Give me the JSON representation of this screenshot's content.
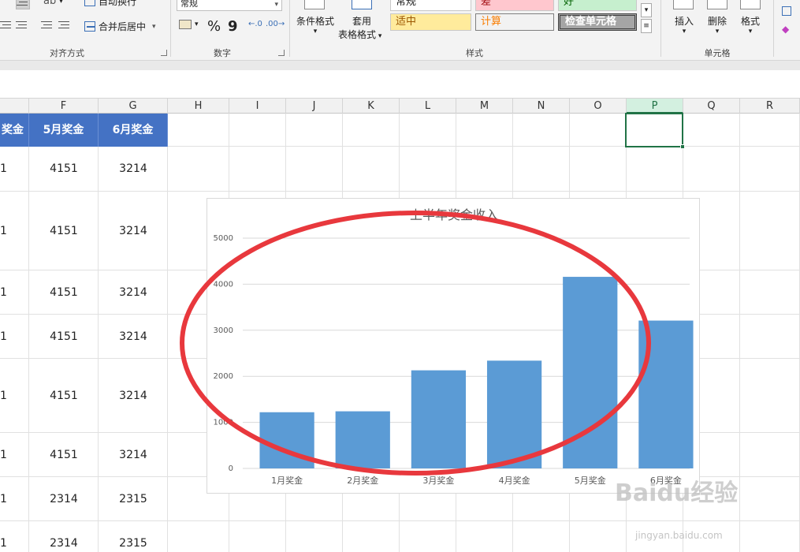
{
  "ribbon": {
    "alignment": {
      "wrap_text": "自动换行",
      "merge_center": "合并后居中",
      "group_label": "对齐方式"
    },
    "number": {
      "format_value": "常规",
      "percent": "%",
      "comma": "9",
      "group_label": "数字"
    },
    "styles": {
      "conditional_format": "条件格式",
      "table_format_line1": "套用",
      "table_format_line2": "表格格式",
      "cells": [
        {
          "label": "常规",
          "bg": "#ffffff",
          "color": "#222222"
        },
        {
          "label": "差",
          "bg": "#ffc7ce",
          "color": "#9c0006"
        },
        {
          "label": "好",
          "bg": "#c6efce",
          "color": "#006100"
        },
        {
          "label": "适中",
          "bg": "#ffeb9c",
          "color": "#9c5700"
        },
        {
          "label": "计算",
          "bg": "#f2f2f2",
          "color": "#fa7d00"
        },
        {
          "label": "检查单元格",
          "bg": "#a5a5a5",
          "color": "#ffffff"
        }
      ],
      "group_label": "样式"
    },
    "cells_group": {
      "insert": "插入",
      "delete": "删除",
      "format": "格式",
      "group_label": "单元格"
    }
  },
  "grid": {
    "columns": [
      "F",
      "G",
      "H",
      "I",
      "J",
      "K",
      "L",
      "M",
      "N",
      "O",
      "P",
      "Q",
      "R"
    ],
    "active_column": "P",
    "headers": [
      "奖金",
      "5月奖金",
      "6月奖金"
    ],
    "rows": [
      [
        "1",
        "4151",
        "3214"
      ],
      [
        "1",
        "4151",
        "3214"
      ],
      [
        "1",
        "4151",
        "3214"
      ],
      [
        "1",
        "4151",
        "3214"
      ],
      [
        "1",
        "4151",
        "3214"
      ],
      [
        "1",
        "4151",
        "3214"
      ],
      [
        "1",
        "2314",
        "2315"
      ],
      [
        "1",
        "2314",
        "2315"
      ]
    ]
  },
  "chart_data": {
    "type": "bar",
    "title": "上半年奖金收入",
    "categories": [
      "1月奖金",
      "2月奖金",
      "3月奖金",
      "4月奖金",
      "5月奖金",
      "6月奖金"
    ],
    "values": [
      1220,
      1240,
      2130,
      2340,
      4160,
      3210
    ],
    "ylim": [
      0,
      5000
    ],
    "yticks": [
      "0",
      "1000",
      "2000",
      "3000",
      "4000",
      "5000"
    ],
    "xlabel": "",
    "ylabel": "",
    "grid": true,
    "bar_color": "#5b9bd5"
  },
  "annotation": {
    "color": "#e8383d"
  },
  "watermark": {
    "text": "Baidu经验",
    "sub": "jingyan.baidu.com"
  }
}
